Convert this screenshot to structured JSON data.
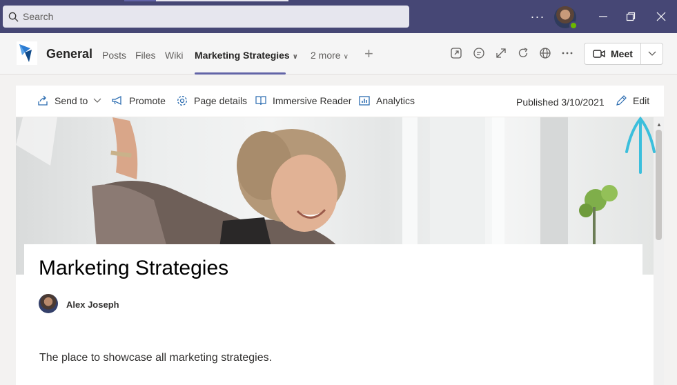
{
  "titlebar": {
    "search_placeholder": "Search",
    "more_label": "···"
  },
  "channel": {
    "name": "General",
    "tabs": [
      {
        "label": "Posts"
      },
      {
        "label": "Files"
      },
      {
        "label": "Wiki"
      },
      {
        "label": "Marketing Strategies"
      },
      {
        "label": "2 more"
      }
    ],
    "meet_label": "Meet"
  },
  "commands": {
    "send_to": "Send to",
    "promote": "Promote",
    "page_details": "Page details",
    "immersive_reader": "Immersive Reader",
    "analytics": "Analytics",
    "published": "Published 3/10/2021",
    "edit": "Edit"
  },
  "page": {
    "title": "Marketing Strategies",
    "author": "Alex Joseph",
    "description": "The place to showcase all marketing strategies."
  },
  "colors": {
    "titlebar": "#464775",
    "accent": "#6264a7",
    "annotation_arrow": "#3bbfdc"
  }
}
